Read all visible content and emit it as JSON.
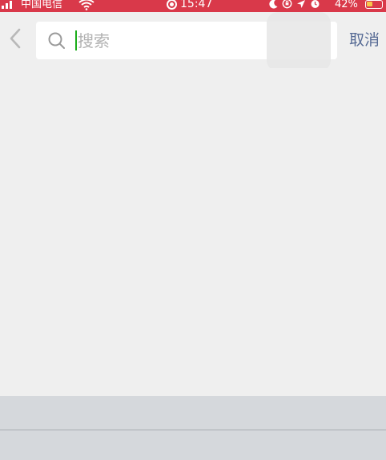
{
  "status_bar": {
    "carrier": "中国电信",
    "time": "15:47",
    "battery_percent": "42%",
    "battery_level": 0.42,
    "background_color": "#d9394a",
    "icons": [
      "signal-icon",
      "wifi-icon",
      "screen-record-icon",
      "moon-icon",
      "orientation-lock-icon",
      "location-icon",
      "alarm-icon",
      "battery-icon"
    ]
  },
  "search": {
    "placeholder": "搜索",
    "value": "",
    "caret_color": "#1aad19"
  },
  "nav": {
    "back_icon": "chevron-left-icon",
    "cancel_label": "取消",
    "cancel_color": "#576b95"
  },
  "colors": {
    "page_background": "#efefef",
    "keyboard_background": "#d5d8dc"
  }
}
